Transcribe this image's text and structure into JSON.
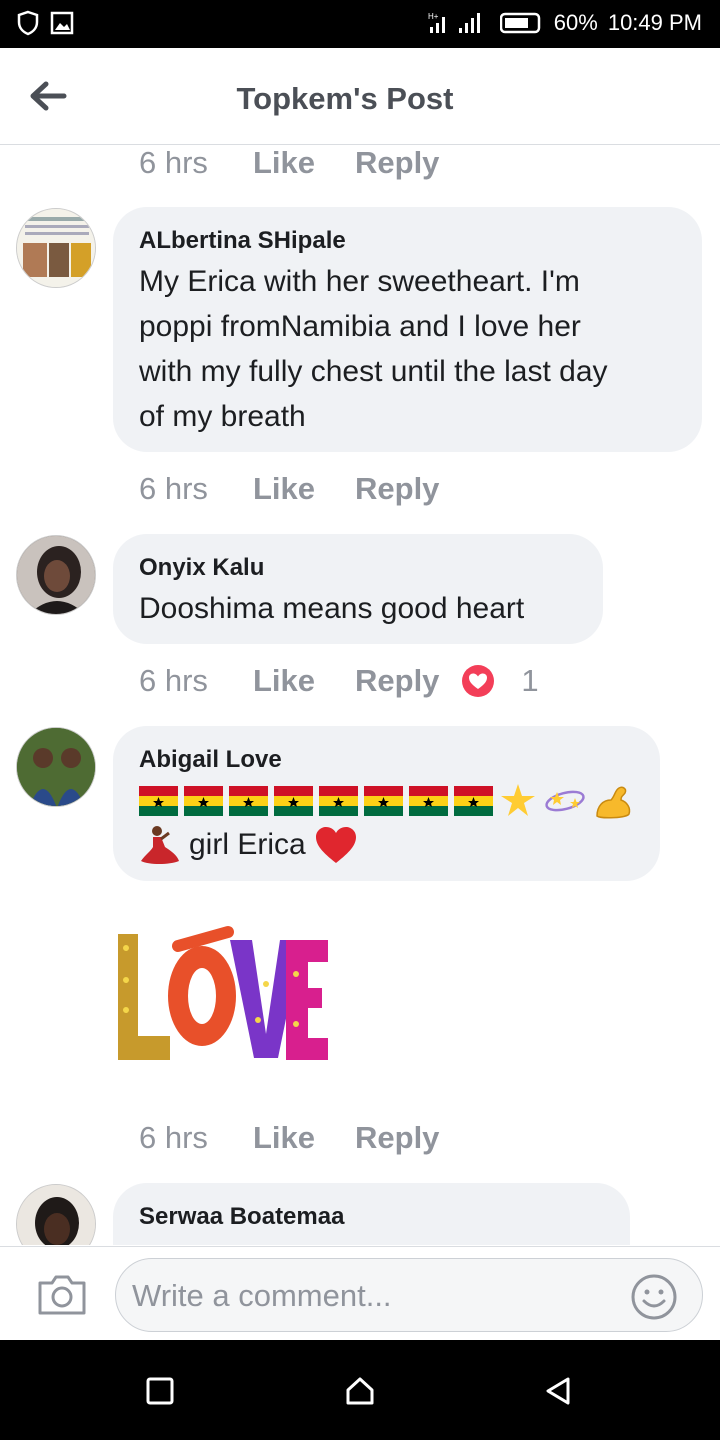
{
  "status_bar": {
    "battery": "60%",
    "time": "10:49 PM",
    "icons": [
      "shield-icon",
      "image-icon",
      "signal-icon",
      "battery-icon"
    ]
  },
  "header": {
    "title": "Topkem's Post",
    "back_icon": "back-arrow-icon"
  },
  "top_actions": {
    "time": "6 hrs",
    "like": "Like",
    "reply": "Reply"
  },
  "comments": [
    {
      "name": "ALbertina SHipale",
      "lines": [
        "My Erica with her sweetheart. I'm",
        "poppi fromNamibia and I love her",
        "with my fully chest until the last day",
        "of my breath"
      ],
      "actions": {
        "time": "6 hrs",
        "like": "Like",
        "reply": "Reply"
      }
    },
    {
      "name": "Onyix Kalu",
      "lines": [
        "Dooshima means good heart"
      ],
      "actions": {
        "time": "6 hrs",
        "like": "Like",
        "reply": "Reply",
        "reaction_count": "1",
        "reaction_icon": "love-reaction-icon"
      }
    },
    {
      "name": "Abigail Love",
      "line2": "girl Erica",
      "sticker": "LOVE",
      "actions": {
        "time": "6 hrs",
        "like": "Like",
        "reply": "Reply"
      }
    },
    {
      "name": "Serwaa Boatemaa"
    }
  ],
  "composer": {
    "placeholder": "Write a comment...",
    "camera_icon": "camera-icon",
    "emoji_icon": "smiley-icon"
  },
  "nav_bar": {
    "icons": [
      "square-icon",
      "home-icon",
      "back-triangle-icon"
    ]
  },
  "colors": {
    "accent": "#4b4f56",
    "muted": "#90949c",
    "bubble": "#f0f2f5",
    "love": "#f33e58"
  }
}
